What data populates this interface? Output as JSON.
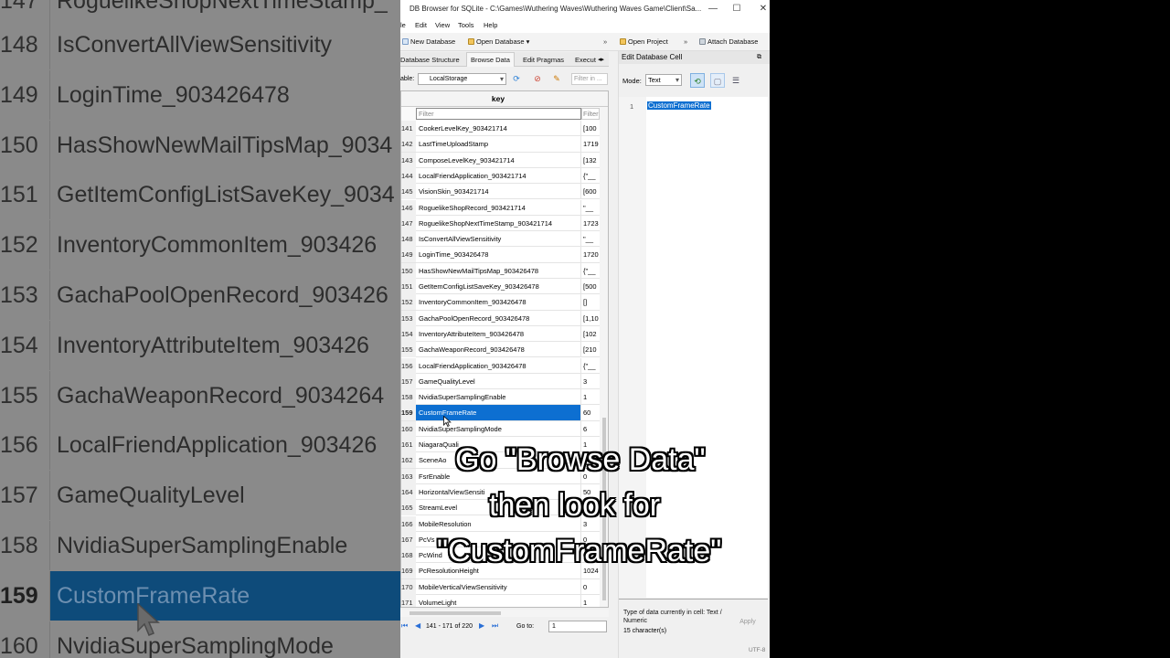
{
  "background_zoom": {
    "rows": [
      {
        "num": "148",
        "key": "IsConvertAllViewSensitivity"
      },
      {
        "num": "149",
        "key": "LoginTime_903426478"
      },
      {
        "num": "150",
        "key": "HasShowNewMailTipsMap_9034"
      },
      {
        "num": "151",
        "key": "GetItemConfigListSaveKey_9034"
      },
      {
        "num": "152",
        "key": "InventoryCommonItem_903426"
      },
      {
        "num": "153",
        "key": "GachaPoolOpenRecord_903426"
      },
      {
        "num": "154",
        "key": "InventoryAttributeItem_903426"
      },
      {
        "num": "155",
        "key": "GachaWeaponRecord_9034264"
      },
      {
        "num": "156",
        "key": "LocalFriendApplication_903426"
      },
      {
        "num": "157",
        "key": "GameQualityLevel"
      },
      {
        "num": "158",
        "key": "NvidiaSuperSamplingEnable"
      },
      {
        "num": "159",
        "key": "CustomFrameRate"
      },
      {
        "num": "160",
        "key": "NvidiaSuperSamplingMode"
      }
    ],
    "top_partial": {
      "num": "147",
      "key": "RoguelikeShopNextTimeStamp_"
    }
  },
  "window": {
    "title": "DB Browser for SQLite - C:\\Games\\Wuthering Waves\\Wuthering Waves Game\\Client\\Sa...",
    "controls": {
      "minimize": "—",
      "maximize": "☐",
      "close": "✕"
    }
  },
  "menu": [
    "le",
    "Edit",
    "View",
    "Tools",
    "Help"
  ],
  "toolbar": {
    "new_database": "New Database",
    "open_database": "Open Database",
    "open_project": "Open Project",
    "attach_database": "Attach Database"
  },
  "tabs": [
    "Database Structure",
    "Browse Data",
    "Edit Pragmas",
    "Execut"
  ],
  "table_selector": {
    "label": "able:",
    "value": "LocalStorage",
    "filter_placeholder": "Filter in ..."
  },
  "grid": {
    "column_key": "key",
    "filter_placeholder": "Filter",
    "filter2_placeholder": "Filter",
    "rows": [
      {
        "num": "141",
        "key": "CookerLevelKey_903421714",
        "value": "[100"
      },
      {
        "num": "142",
        "key": "LastTimeUploadStamp",
        "value": "1719"
      },
      {
        "num": "143",
        "key": "ComposeLevelKey_903421714",
        "value": "[132"
      },
      {
        "num": "144",
        "key": "LocalFriendApplication_903421714",
        "value": "{\"__"
      },
      {
        "num": "145",
        "key": "VisionSkin_903421714",
        "value": "[600"
      },
      {
        "num": "146",
        "key": "RoguelikeShopRecord_903421714",
        "value": "\"__"
      },
      {
        "num": "147",
        "key": "RoguelikeShopNextTimeStamp_903421714",
        "value": "1723"
      },
      {
        "num": "148",
        "key": "IsConvertAllViewSensitivity",
        "value": "\"__"
      },
      {
        "num": "149",
        "key": "LoginTime_903426478",
        "value": "1720"
      },
      {
        "num": "150",
        "key": "HasShowNewMailTipsMap_903426478",
        "value": "{\"__"
      },
      {
        "num": "151",
        "key": "GetItemConfigListSaveKey_903426478",
        "value": "[500"
      },
      {
        "num": "152",
        "key": "InventoryCommonItem_903426478",
        "value": "[]"
      },
      {
        "num": "153",
        "key": "GachaPoolOpenRecord_903426478",
        "value": "[1,10"
      },
      {
        "num": "154",
        "key": "InventoryAttributeItem_903426478",
        "value": "[102"
      },
      {
        "num": "155",
        "key": "GachaWeaponRecord_903426478",
        "value": "[210"
      },
      {
        "num": "156",
        "key": "LocalFriendApplication_903426478",
        "value": "{\"__"
      },
      {
        "num": "157",
        "key": "GameQualityLevel",
        "value": "3"
      },
      {
        "num": "158",
        "key": "NvidiaSuperSamplingEnable",
        "value": "1"
      },
      {
        "num": "159",
        "key": "CustomFrameRate",
        "value": "60"
      },
      {
        "num": "160",
        "key": "NvidiaSuperSamplingMode",
        "value": "6"
      },
      {
        "num": "161",
        "key": "NiagaraQuali",
        "value": "1"
      },
      {
        "num": "162",
        "key": "SceneAo",
        "value": "1"
      },
      {
        "num": "163",
        "key": "FsrEnable",
        "value": "0"
      },
      {
        "num": "164",
        "key": "HorizontalViewSensiti",
        "value": "50"
      },
      {
        "num": "165",
        "key": "StreamLevel",
        "value": "2"
      },
      {
        "num": "166",
        "key": "MobileResolution",
        "value": "3"
      },
      {
        "num": "167",
        "key": "PcVs",
        "value": "0"
      },
      {
        "num": "168",
        "key": "PcWind",
        "value": "0"
      },
      {
        "num": "169",
        "key": "PcResolutionHeight",
        "value": "1024"
      },
      {
        "num": "170",
        "key": "MobileVerticalViewSensitivity",
        "value": "0"
      },
      {
        "num": "171",
        "key": "VolumeLight",
        "value": "1"
      }
    ]
  },
  "navigation": {
    "count": "141 - 171 of 220",
    "goto_label": "Go to:",
    "goto_value": "1"
  },
  "edit_cell": {
    "title": "Edit Database Cell",
    "mode_label": "Mode:",
    "mode_value": "Text",
    "line_number": "1",
    "cell_text": "CustomFrameRate",
    "type_info": "Type of data currently in cell: Text / Numeric",
    "chars": "15 character(s)",
    "apply": "Apply",
    "encoding": "UTF-8"
  },
  "caption": {
    "line1": "Go \"Browse Data\"",
    "line2": "then look for",
    "line3": "\"CustomFrameRate\""
  },
  "colors": {
    "selection": "#0d6fd1",
    "zoom_selection": "#0e4b7a"
  }
}
